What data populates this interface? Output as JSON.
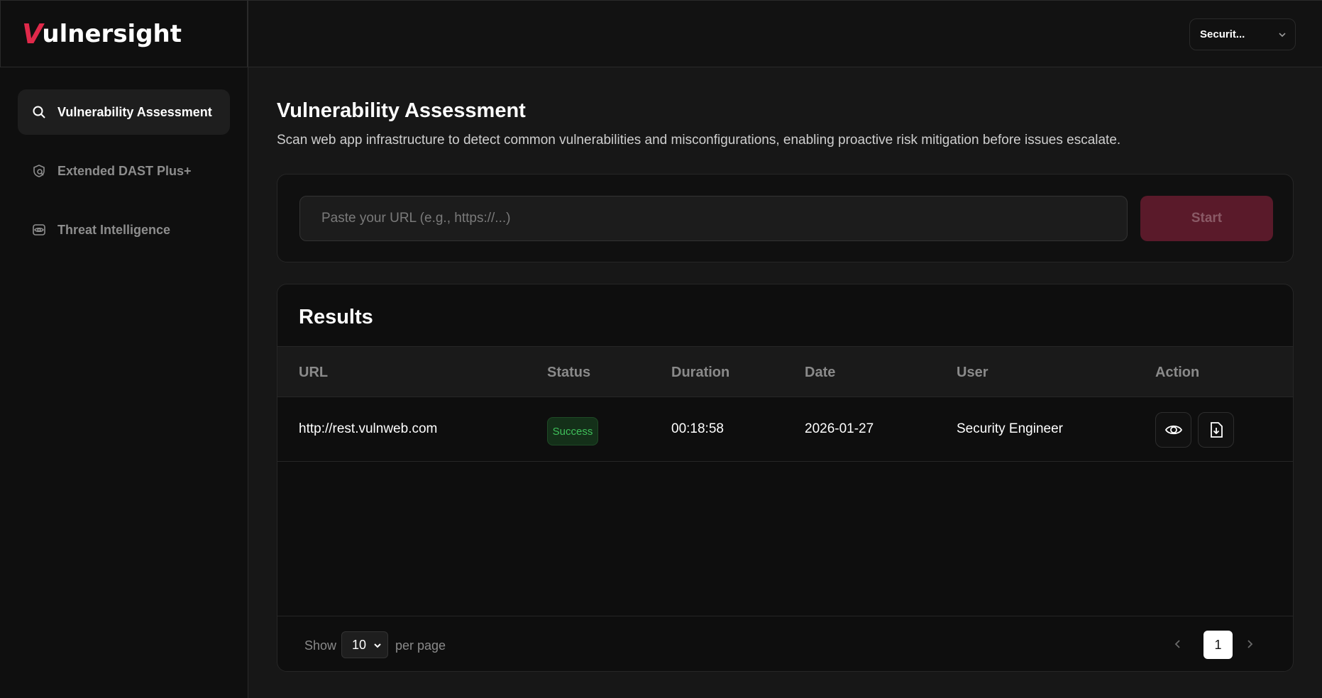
{
  "brand": {
    "logo_first": "V",
    "logo_rest": "ulnersight"
  },
  "sidebar": {
    "items": [
      {
        "label": "Vulnerability Assessment",
        "icon": "search-icon",
        "active": true
      },
      {
        "label": "Extended DAST Plus+",
        "icon": "shield-search-icon",
        "active": false
      },
      {
        "label": "Threat Intelligence",
        "icon": "eye-icon",
        "active": false
      }
    ]
  },
  "header": {
    "user_select": "Securit..."
  },
  "main": {
    "title": "Vulnerability Assessment",
    "description": "Scan web app infrastructure to detect common vulnerabilities and misconfigurations, enabling proactive risk mitigation before issues escalate.",
    "url_placeholder": "Paste your URL (e.g., https://...)",
    "url_value": "",
    "start_label": "Start"
  },
  "results": {
    "title": "Results",
    "columns": [
      "URL",
      "Status",
      "Duration",
      "Date",
      "User",
      "Action"
    ],
    "rows": [
      {
        "url": "http://rest.vulnweb.com",
        "status": "Success",
        "duration": "00:18:58",
        "date": "2026-01-27",
        "user": "Security Engineer"
      }
    ]
  },
  "pagination": {
    "show_label": "Show",
    "per_page_value": "10",
    "per_page_label": "per page",
    "current_page": "1"
  },
  "colors": {
    "accent": "#e0294a",
    "start_button": "#5a1a2a",
    "success": "#3fbf5a"
  }
}
